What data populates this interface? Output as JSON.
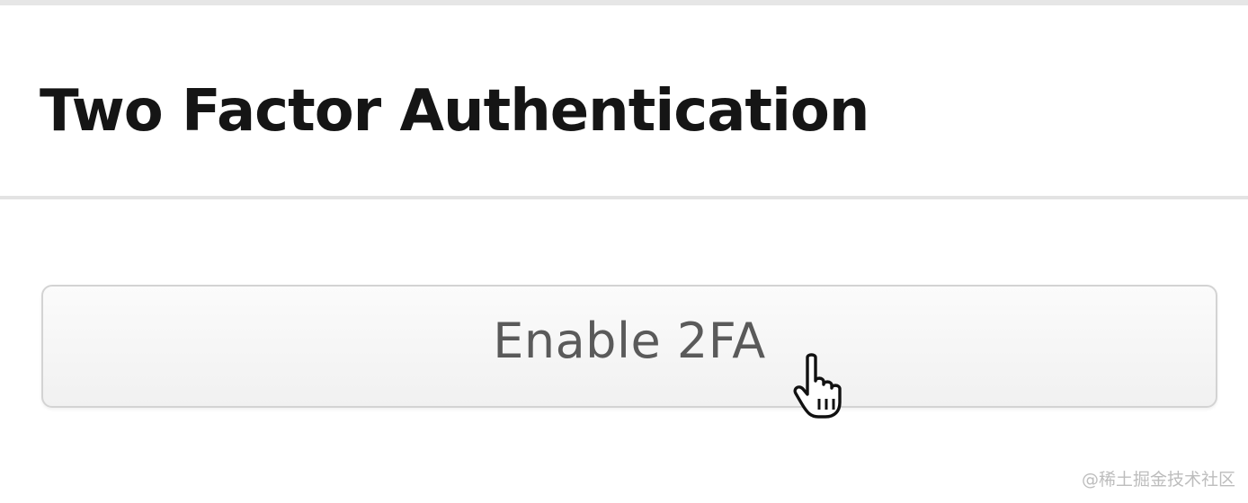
{
  "section": {
    "title": "Two Factor Authentication"
  },
  "actions": {
    "enable_2fa_label": "Enable 2FA"
  },
  "cursor": {
    "icon": "hand-pointer-icon"
  },
  "watermark": {
    "text": "@稀土掘金技术社区"
  }
}
